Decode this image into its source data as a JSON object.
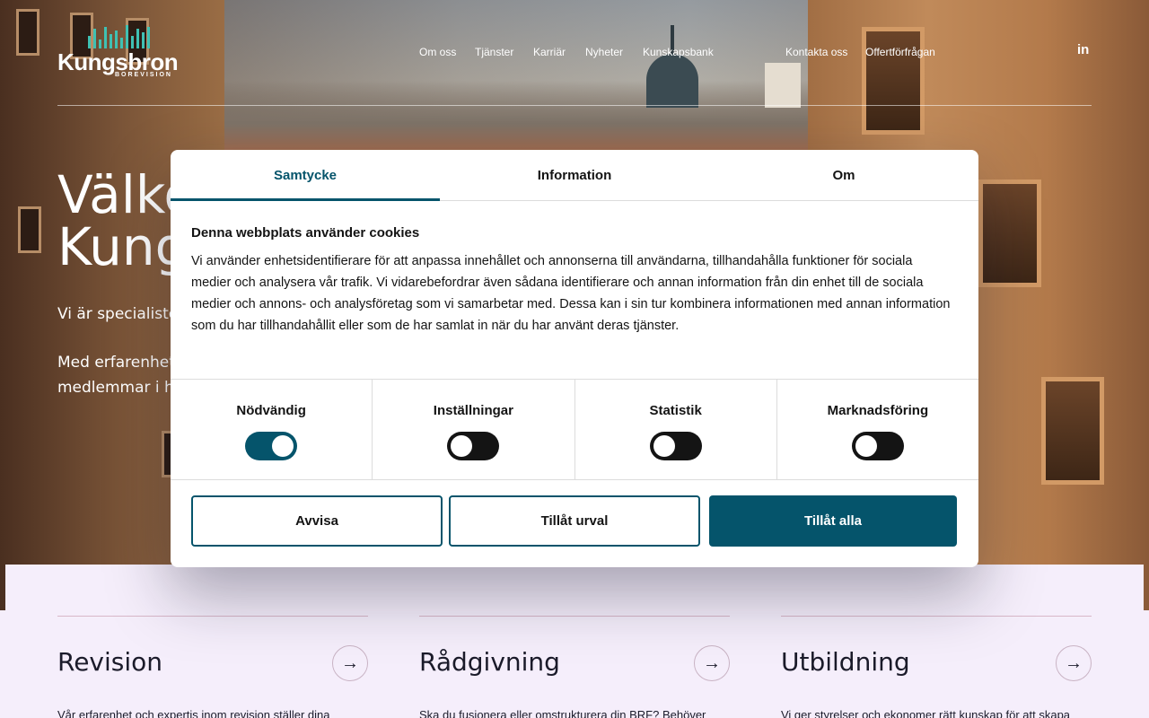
{
  "header": {
    "logo": {
      "name": "Kungsbron",
      "sub": "BOREVISION"
    },
    "nav": [
      "Om oss",
      "Tjänster",
      "Karriär",
      "Nyheter",
      "Kunskapsbank"
    ],
    "nav_right": [
      "Kontakta oss",
      "Offertförfrågan"
    ],
    "social": "in"
  },
  "hero": {
    "title_line1": "Välko",
    "title_line2": "Kung",
    "intro": "Vi är specialister",
    "body_line1": "Med erfarenhet o",
    "body_line2": "medlemmar i he"
  },
  "services": [
    {
      "title": "Revision",
      "desc": "Vår erfarenhet och expertis inom revision ställer dina"
    },
    {
      "title": "Rådgivning",
      "desc": "Ska du fusionera eller omstrukturera din BRF? Behöver"
    },
    {
      "title": "Utbildning",
      "desc": "Vi ger styrelser och ekonomer rätt kunskap för att skapa"
    }
  ],
  "cookie_dialog": {
    "tabs": [
      "Samtycke",
      "Information",
      "Om"
    ],
    "active_tab": "Samtycke",
    "heading": "Denna webbplats använder cookies",
    "body": "Vi använder enhetsidentifierare för att anpassa innehållet och annonserna till användarna, tillhandahålla funktioner för sociala medier och analysera vår trafik. Vi vidarebefordrar även sådana identifierare och annan information från din enhet till de sociala medier och annons- och analysföretag som vi samarbetar med. Dessa kan i sin tur kombinera informationen med annan information som du har tillhandahållit eller som de har samlat in när du har använt deras tjänster.",
    "toggles": [
      {
        "label": "Nödvändig",
        "on": true
      },
      {
        "label": "Inställningar",
        "on": false
      },
      {
        "label": "Statistik",
        "on": false
      },
      {
        "label": "Marknadsföring",
        "on": false
      }
    ],
    "buttons": {
      "reject": "Avvisa",
      "allow_selection": "Tillåt urval",
      "allow_all": "Tillåt alla"
    },
    "colors": {
      "primary": "#05546b",
      "toggle_off": "#141414"
    }
  },
  "icons": {
    "arrow": "arrow-right-icon",
    "linkedin": "linkedin-icon"
  }
}
